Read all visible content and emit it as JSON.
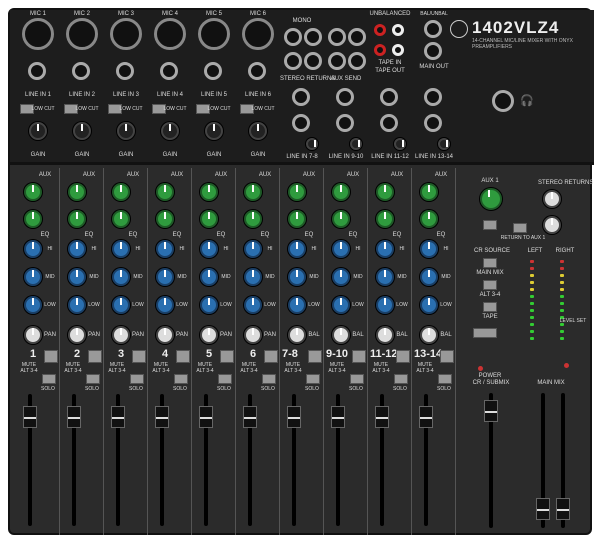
{
  "brand": {
    "model": "1402VLZ4",
    "subtitle": "14-CHANNEL MIC/LINE MIXER WITH ONYX PREAMPLIFIERS",
    "logo": "mackie-running-man"
  },
  "top_panel": {
    "mic_labels": [
      "MIC 1",
      "MIC 2",
      "MIC 3",
      "MIC 4",
      "MIC 5",
      "MIC 6"
    ],
    "line_labels": [
      "LINE IN 1",
      "LINE IN 2",
      "LINE IN 3",
      "LINE IN 4",
      "LINE IN 5",
      "LINE IN 6"
    ],
    "stereo_line_labels": [
      "LINE IN 7-8",
      "LINE IN 9-10",
      "LINE IN 11-12",
      "LINE IN 13-14"
    ],
    "low_cut": "LOW CUT",
    "gain": "GAIN",
    "stereo_returns": "STEREO RETURNS",
    "aux_send": "AUX SEND",
    "tape_in": "TAPE IN",
    "tape_out": "TAPE OUT",
    "main_out": "MAIN OUT",
    "unbalanced": "UNBALANCED",
    "bal_unbal": "BAL/UNBAL",
    "mono": "MONO",
    "headphones_icon": "headphones-icon"
  },
  "channels": [
    {
      "number": "1",
      "pan": "PAN"
    },
    {
      "number": "2",
      "pan": "PAN"
    },
    {
      "number": "3",
      "pan": "PAN"
    },
    {
      "number": "4",
      "pan": "PAN"
    },
    {
      "number": "5",
      "pan": "PAN"
    },
    {
      "number": "6",
      "pan": "PAN"
    },
    {
      "number": "7-8",
      "pan": "BAL"
    },
    {
      "number": "9-10",
      "pan": "BAL"
    },
    {
      "number": "11-12",
      "pan": "BAL"
    },
    {
      "number": "13-14",
      "pan": "BAL"
    }
  ],
  "strip": {
    "aux": "AUX",
    "eq": "EQ",
    "hi": "HI",
    "mid": "MID",
    "low": "LOW",
    "mute": "MUTE",
    "alt": "ALT 3-4",
    "solo": "SOLO"
  },
  "master": {
    "aux1": "AUX 1",
    "stereo_returns": "STEREO RETURNS",
    "cr_source": "CR SOURCE",
    "main_mix": "MAIN MIX",
    "alt34": "ALT 3-4",
    "tape": "TAPE",
    "left": "LEFT",
    "right": "RIGHT",
    "level_set": "LEVEL SET",
    "power": "POWER",
    "cr_submix": "CR / SUBMIX",
    "main_mix_fader": "MAIN MIX",
    "return_to_aux1": "RETURN TO AUX 1"
  },
  "colors": {
    "body": "#2b2b2b",
    "aux_knob": "#2f9b3e",
    "eq_knob": "#2a6fb0"
  }
}
